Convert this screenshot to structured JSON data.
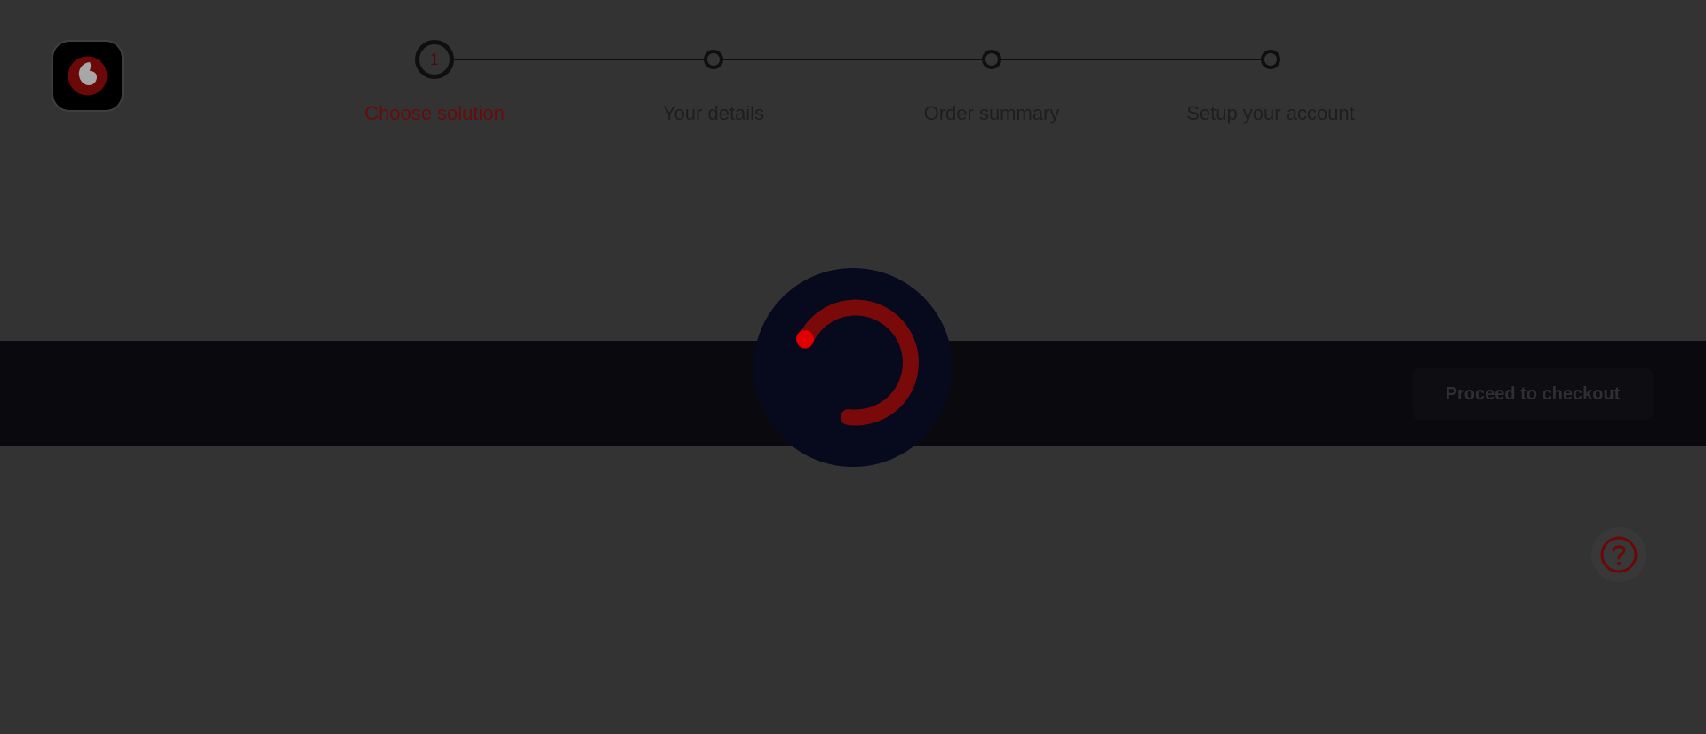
{
  "logo": {
    "icon": "vodafone-logo-icon",
    "accent": "#7a0a0a"
  },
  "stepper": {
    "steps": [
      {
        "number": "1",
        "label": "Choose solution",
        "state": "active"
      },
      {
        "label": "Your details",
        "state": "pending"
      },
      {
        "label": "Order summary",
        "state": "pending"
      },
      {
        "label": "Setup your account",
        "state": "pending"
      }
    ]
  },
  "checkout": {
    "label": "Proceed to checkout"
  },
  "loader": {
    "icon": "loading-spinner-icon",
    "ring_color": "#7a0a0a",
    "dot_color": "#e00000",
    "background": "#07091c"
  },
  "help": {
    "icon": "help-question-icon",
    "color": "#6a0808"
  },
  "colors": {
    "overlay_background": "#333333",
    "band_background": "#0a0a0e",
    "active_step_text": "#660c0c"
  }
}
